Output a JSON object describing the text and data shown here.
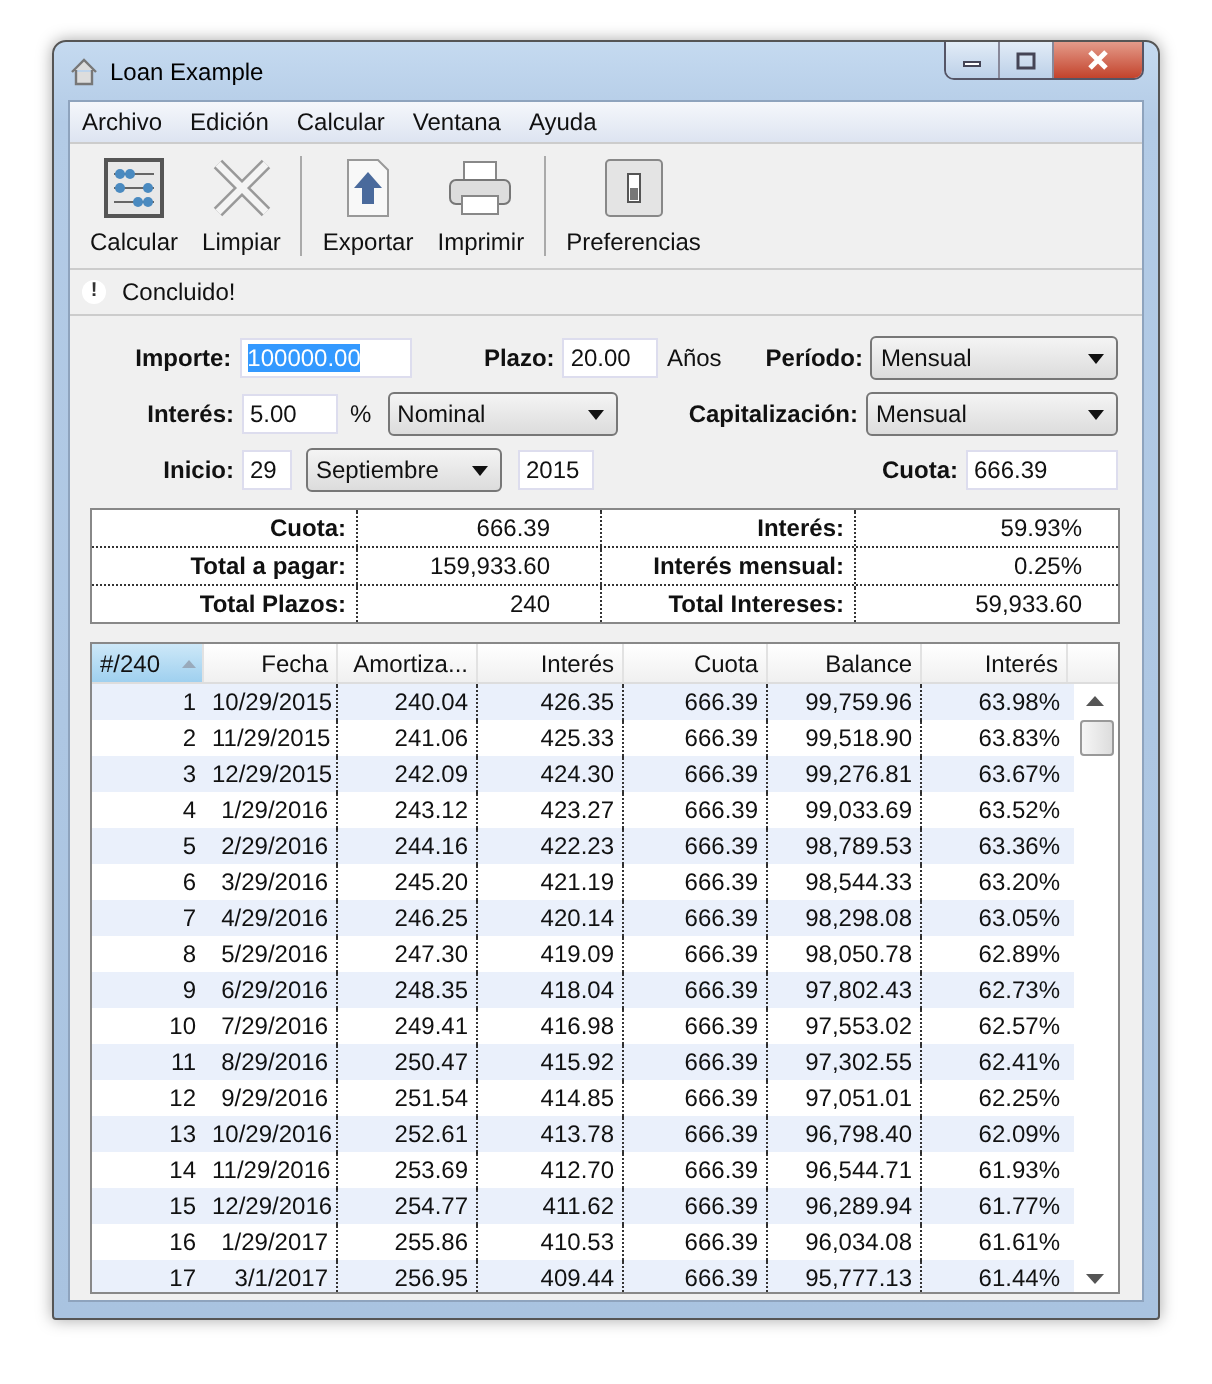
{
  "window": {
    "title": "Loan Example"
  },
  "menu": [
    "Archivo",
    "Edición",
    "Calcular",
    "Ventana",
    "Ayuda"
  ],
  "toolbar": [
    {
      "kind": "abacus",
      "label": "Calcular"
    },
    {
      "kind": "clear",
      "label": "Limpiar"
    },
    {
      "kind": "separator"
    },
    {
      "kind": "export",
      "label": "Exportar"
    },
    {
      "kind": "print",
      "label": "Imprimir"
    },
    {
      "kind": "separator"
    },
    {
      "kind": "switch",
      "label": "Preferencias"
    }
  ],
  "status": {
    "icon": "!",
    "message": "Concluido!"
  },
  "form": {
    "importe": {
      "label": "Importe:",
      "value": "100000.00",
      "text_selected": true
    },
    "plazo": {
      "label": "Plazo:",
      "value": "20.00",
      "unit": "Años"
    },
    "periodo": {
      "label": "Período:",
      "value": "Mensual"
    },
    "interes": {
      "label": "Interés:",
      "value": "5.00",
      "unit": "%",
      "type": "Nominal"
    },
    "capitalizacion": {
      "label": "Capitalización:",
      "value": "Mensual"
    },
    "inicio": {
      "label": "Inicio:",
      "day": "29",
      "month": "Septiembre",
      "year": "2015"
    },
    "cuota": {
      "label": "Cuota:",
      "value": "666.39"
    }
  },
  "summary": [
    {
      "label": "Cuota:",
      "value": "666.39",
      "label_2": "Interés:",
      "value_2": "59.93%"
    },
    {
      "label": "Total a pagar:",
      "value": "159,933.60",
      "label_2": "Interés mensual:",
      "value_2": "0.25%"
    },
    {
      "label": "Total Plazos:",
      "value": "240",
      "label_2": "Total Intereses:",
      "value_2": "59,933.60"
    }
  ],
  "table": {
    "columns": [
      {
        "label": "#/240",
        "selected": true
      },
      {
        "label": "Fecha",
        "selected": false
      },
      {
        "label": "Amortiza...",
        "selected": false
      },
      {
        "label": "Interés",
        "selected": false
      },
      {
        "label": "Cuota",
        "selected": false
      },
      {
        "label": "Balance",
        "selected": false
      },
      {
        "label": "Interés",
        "selected": false
      }
    ],
    "rows": [
      [
        "1",
        "10/29/2015",
        "240.04",
        "426.35",
        "666.39",
        "99,759.96",
        "63.98%"
      ],
      [
        "2",
        "11/29/2015",
        "241.06",
        "425.33",
        "666.39",
        "99,518.90",
        "63.83%"
      ],
      [
        "3",
        "12/29/2015",
        "242.09",
        "424.30",
        "666.39",
        "99,276.81",
        "63.67%"
      ],
      [
        "4",
        "1/29/2016",
        "243.12",
        "423.27",
        "666.39",
        "99,033.69",
        "63.52%"
      ],
      [
        "5",
        "2/29/2016",
        "244.16",
        "422.23",
        "666.39",
        "98,789.53",
        "63.36%"
      ],
      [
        "6",
        "3/29/2016",
        "245.20",
        "421.19",
        "666.39",
        "98,544.33",
        "63.20%"
      ],
      [
        "7",
        "4/29/2016",
        "246.25",
        "420.14",
        "666.39",
        "98,298.08",
        "63.05%"
      ],
      [
        "8",
        "5/29/2016",
        "247.30",
        "419.09",
        "666.39",
        "98,050.78",
        "62.89%"
      ],
      [
        "9",
        "6/29/2016",
        "248.35",
        "418.04",
        "666.39",
        "97,802.43",
        "62.73%"
      ],
      [
        "10",
        "7/29/2016",
        "249.41",
        "416.98",
        "666.39",
        "97,553.02",
        "62.57%"
      ],
      [
        "11",
        "8/29/2016",
        "250.47",
        "415.92",
        "666.39",
        "97,302.55",
        "62.41%"
      ],
      [
        "12",
        "9/29/2016",
        "251.54",
        "414.85",
        "666.39",
        "97,051.01",
        "62.25%"
      ],
      [
        "13",
        "10/29/2016",
        "252.61",
        "413.78",
        "666.39",
        "96,798.40",
        "62.09%"
      ],
      [
        "14",
        "11/29/2016",
        "253.69",
        "412.70",
        "666.39",
        "96,544.71",
        "61.93%"
      ],
      [
        "15",
        "12/29/2016",
        "254.77",
        "411.62",
        "666.39",
        "96,289.94",
        "61.77%"
      ],
      [
        "16",
        "1/29/2017",
        "255.86",
        "410.53",
        "666.39",
        "96,034.08",
        "61.61%"
      ],
      [
        "17",
        "3/1/2017",
        "256.95",
        "409.44",
        "666.39",
        "95,777.13",
        "61.44%"
      ]
    ]
  }
}
